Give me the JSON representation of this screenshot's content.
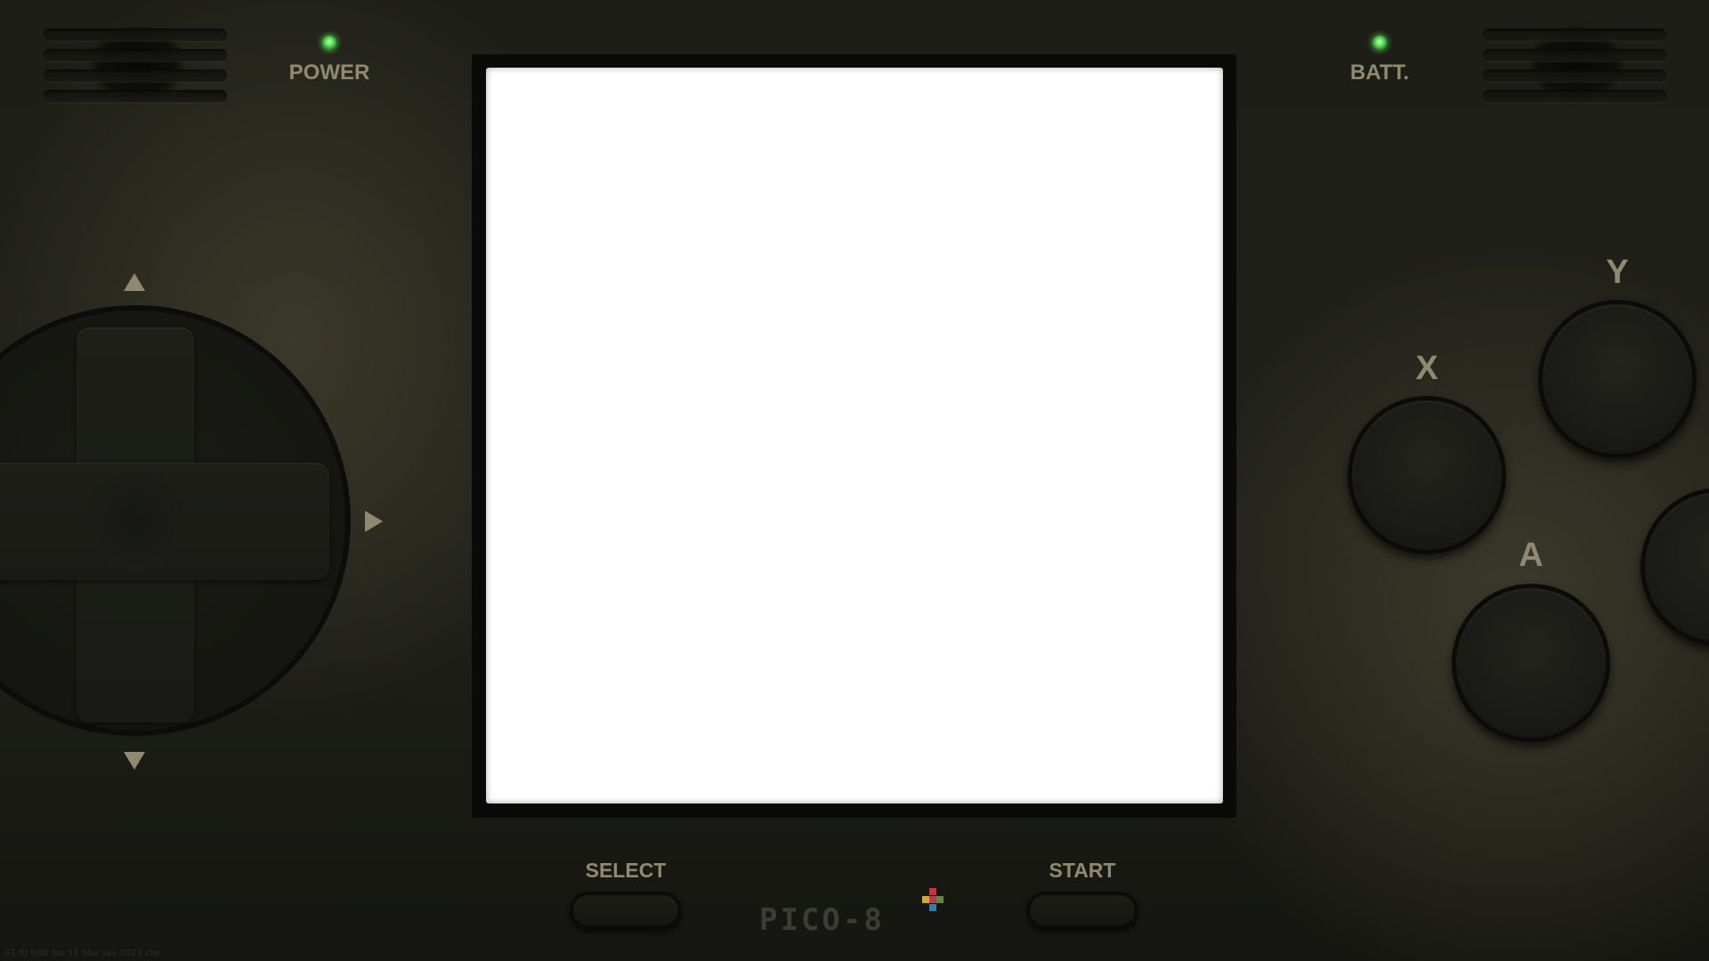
{
  "console": {
    "power_label": "POWER",
    "battery_label": "BATT.",
    "logo_text": "PICO-8",
    "footnote": "G1 f0 fr60 fps 11 blur sys 2023 chk"
  },
  "face_buttons": {
    "x_label": "X",
    "y_label": "Y",
    "a_label": "A"
  },
  "system_buttons": {
    "select_label": "SELECT",
    "start_label": "START"
  },
  "icons": {
    "power_led": "green-led",
    "battery_led": "green-led",
    "dpad_up": "triangle-up",
    "dpad_down": "triangle-down",
    "dpad_right": "triangle-right"
  },
  "colors": {
    "led_green": "#5fe05a",
    "label": "#8f8a6f",
    "screen": "#ffffff",
    "body": "#1d1e17"
  }
}
